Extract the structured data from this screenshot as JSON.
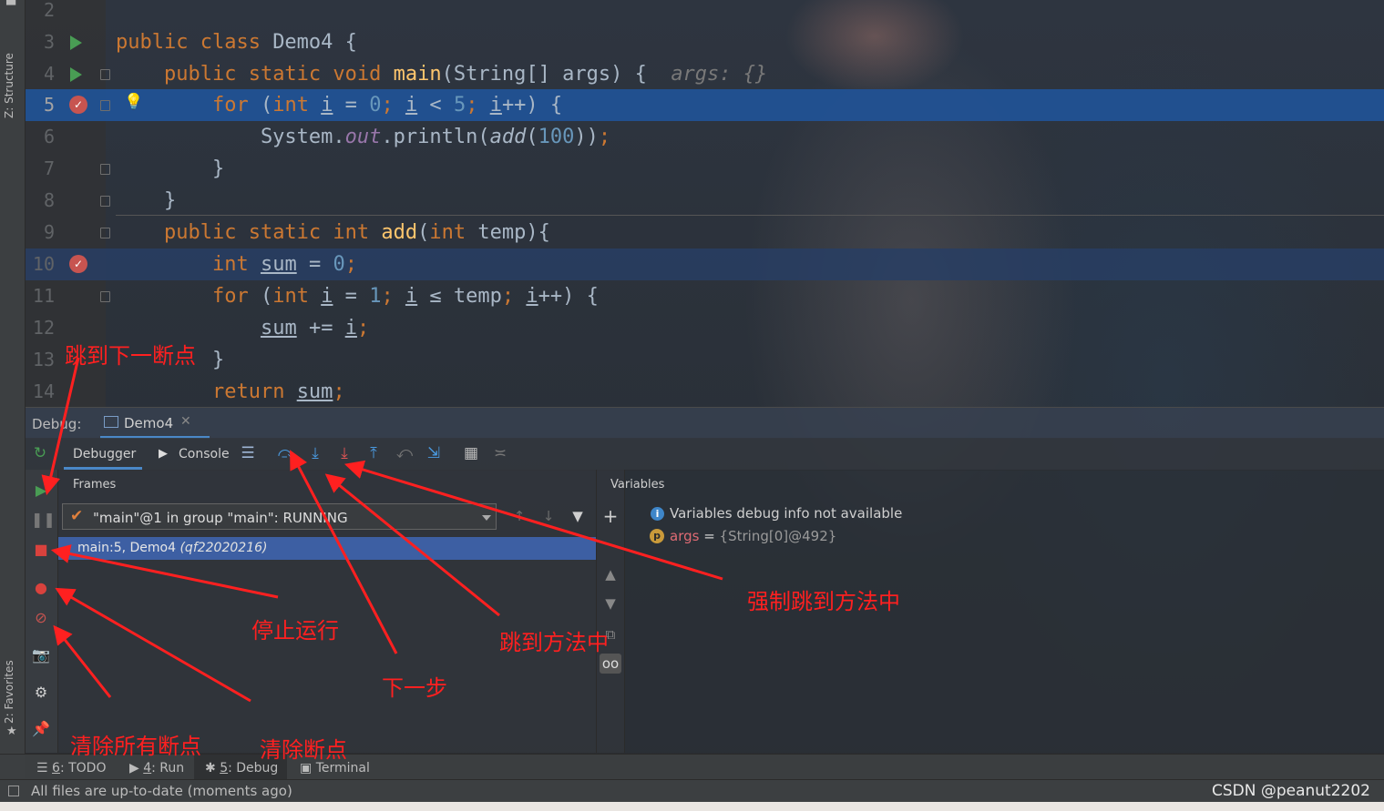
{
  "sidebar": {
    "structure_label": "Z: Structure",
    "favorites_label": "2: Favorites"
  },
  "editor": {
    "lines": [
      {
        "num": "2"
      },
      {
        "num": "3"
      },
      {
        "num": "4",
        "inline_hint": "args: {}"
      },
      {
        "num": "5"
      },
      {
        "num": "6"
      },
      {
        "num": "7"
      },
      {
        "num": "8"
      },
      {
        "num": "9"
      },
      {
        "num": "10"
      },
      {
        "num": "11"
      },
      {
        "num": "12"
      },
      {
        "num": "13"
      },
      {
        "num": "14"
      }
    ]
  },
  "debug": {
    "window_label": "Debug:",
    "session_tab": "Demo4",
    "tabs": {
      "debugger": "Debugger",
      "console": "Console"
    },
    "frames_title": "Frames",
    "thread": "\"main\"@1 in group \"main\": RUNNING",
    "frame": {
      "location": "main:5, Demo4",
      "package": "(qf22020216)"
    },
    "variables_title": "Variables",
    "variables_message": "Variables debug info not available",
    "variable": {
      "name": "args",
      "eq": " = ",
      "value": "{String[0]@492}"
    }
  },
  "bottom_tools": [
    {
      "num": "6",
      "label": ": TODO"
    },
    {
      "num": "4",
      "label": ": Run"
    },
    {
      "num": "5",
      "label": ": Debug"
    },
    {
      "num": "",
      "label": "Terminal"
    }
  ],
  "status": {
    "message": "All files are up-to-date (moments ago)",
    "watermark": "CSDN @peanut2202"
  },
  "annotations": {
    "next_breakpoint": "跳到下一断点",
    "stop": "停止运行",
    "next_step": "下一步",
    "step_into": "跳到方法中",
    "force_step_into": "强制跳到方法中",
    "clear_all_breakpoints": "清除所有断点",
    "clear_breakpoint": "清除断点"
  },
  "colors": {
    "keyword": "#cc7832",
    "number": "#6897bb",
    "method": "#ffc66d",
    "exec_line": "#215296",
    "breakpoint": "#c75450",
    "annotation": "#ff2020"
  }
}
